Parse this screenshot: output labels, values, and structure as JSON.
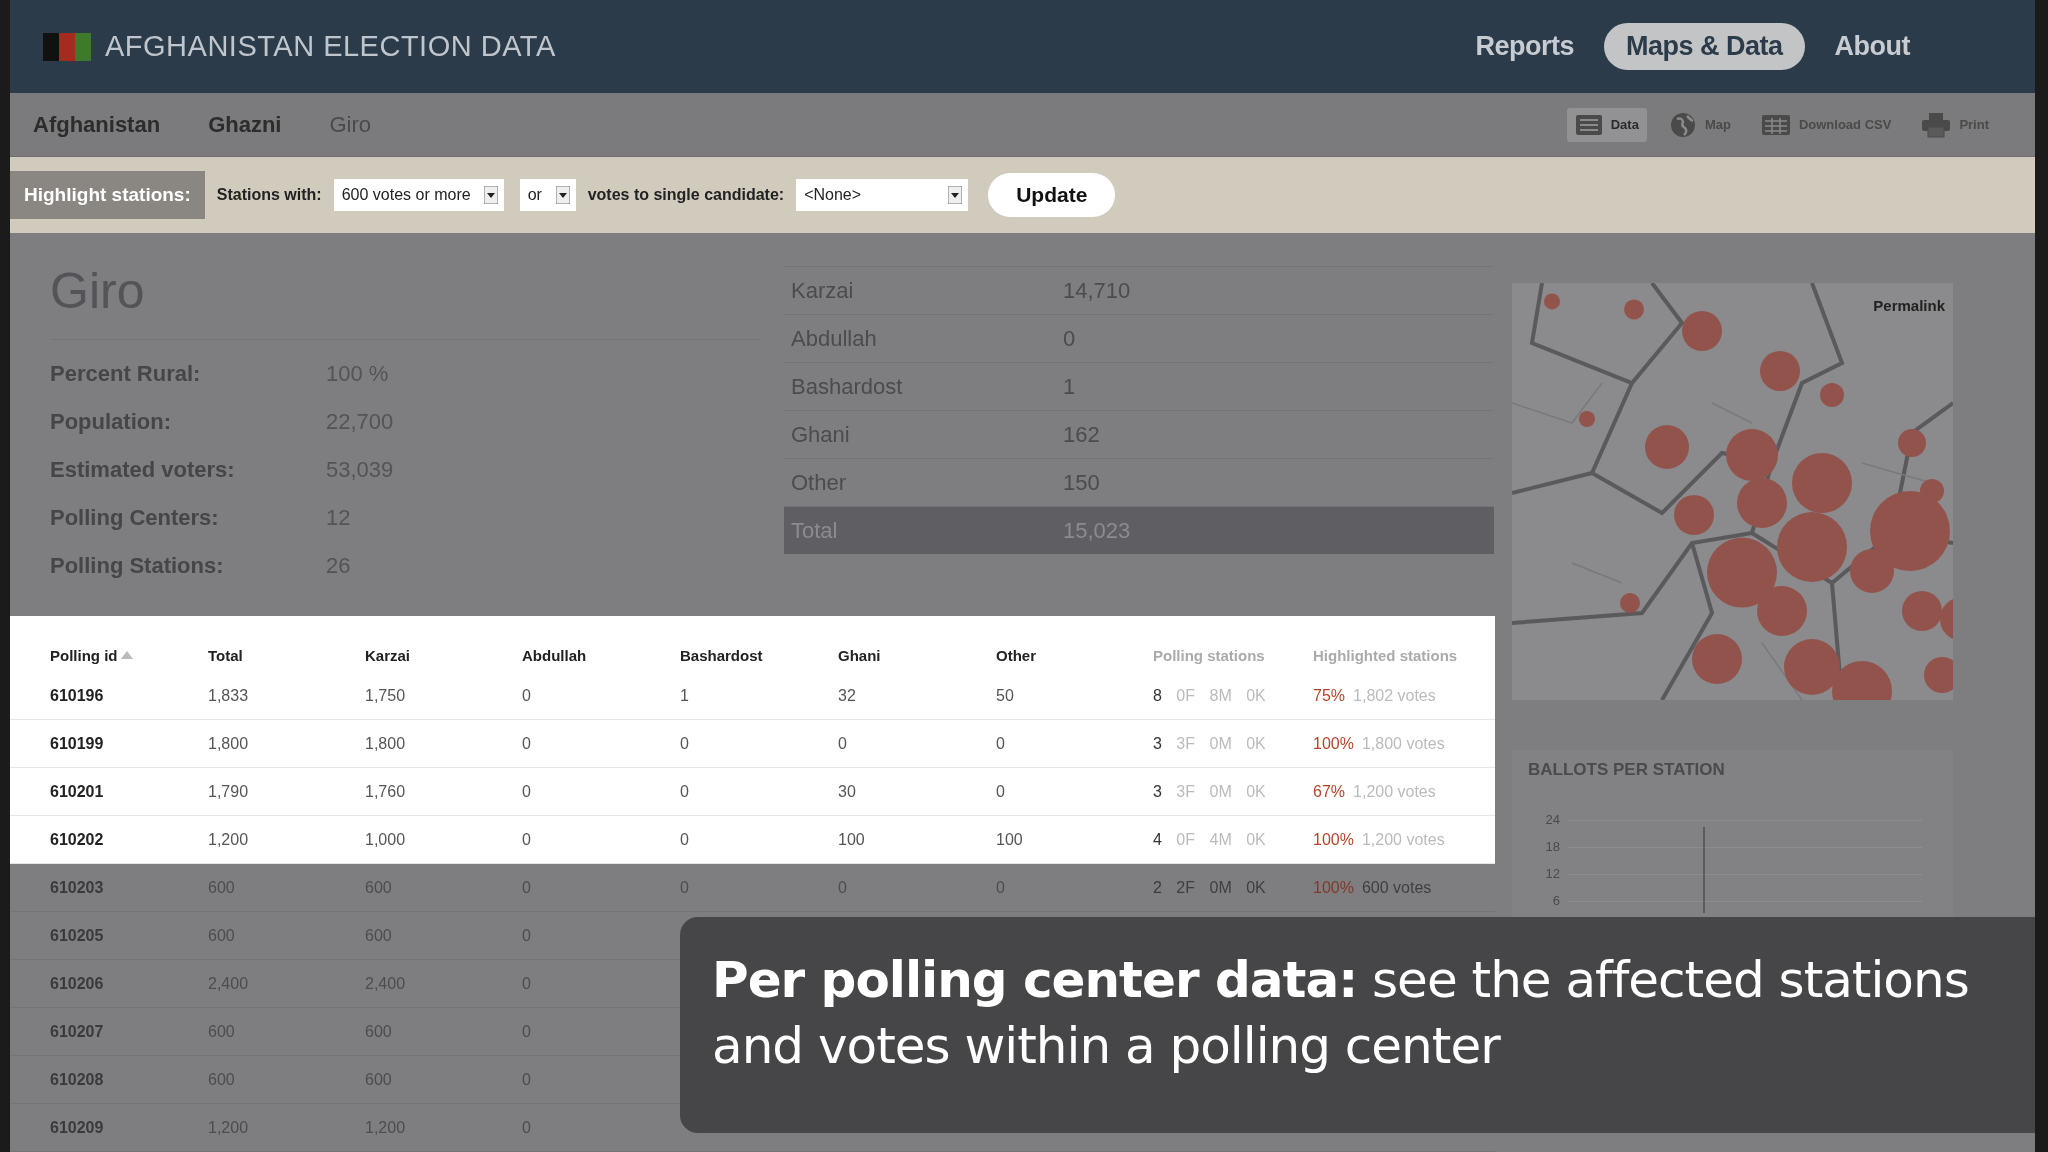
{
  "header": {
    "title": "AFGHANISTAN ELECTION DATA",
    "nav": [
      {
        "label": "Reports",
        "selected": false
      },
      {
        "label": "Maps & Data",
        "selected": true
      },
      {
        "label": "About",
        "selected": false
      }
    ]
  },
  "breadcrumb": [
    {
      "label": "Afghanistan",
      "current": false
    },
    {
      "label": "Ghazni",
      "current": false
    },
    {
      "label": "Giro",
      "current": true
    }
  ],
  "tools": [
    {
      "kind": "data",
      "label": "Data",
      "selected": true
    },
    {
      "kind": "map",
      "label": "Map",
      "selected": false
    },
    {
      "kind": "csv",
      "label": "Download CSV",
      "selected": false
    },
    {
      "kind": "print",
      "label": "Print",
      "selected": false
    }
  ],
  "highlight_bar": {
    "label": "Highlight stations:",
    "stations_label": "Stations with:",
    "threshold": "600 votes or more",
    "operator": "or",
    "candidate_label": "votes to single candidate:",
    "candidate": "<None>",
    "button": "Update"
  },
  "summary": {
    "title": "Giro",
    "stats": [
      {
        "label": "Percent Rural:",
        "value": "100 %"
      },
      {
        "label": "Population:",
        "value": "22,700"
      },
      {
        "label": "Estimated voters:",
        "value": "53,039"
      },
      {
        "label": "Polling Centers:",
        "value": "12"
      },
      {
        "label": "Polling Stations:",
        "value": "26"
      }
    ]
  },
  "candidates": [
    {
      "name": "Karzai",
      "votes": "14,710",
      "total": false
    },
    {
      "name": "Abdullah",
      "votes": "0",
      "total": false
    },
    {
      "name": "Bashardost",
      "votes": "1",
      "total": false
    },
    {
      "name": "Ghani",
      "votes": "162",
      "total": false
    },
    {
      "name": "Other",
      "votes": "150",
      "total": false
    },
    {
      "name": "Total",
      "votes": "15,023",
      "total": true
    }
  ],
  "table": {
    "columns": [
      {
        "label": "Polling id",
        "sorted": true,
        "dimmed": false
      },
      {
        "label": "Total",
        "sorted": false,
        "dimmed": false
      },
      {
        "label": "Karzai",
        "sorted": false,
        "dimmed": false
      },
      {
        "label": "Abdullah",
        "sorted": false,
        "dimmed": false
      },
      {
        "label": "Bashardost",
        "sorted": false,
        "dimmed": false
      },
      {
        "label": "Ghani",
        "sorted": false,
        "dimmed": false
      },
      {
        "label": "Other",
        "sorted": false,
        "dimmed": false
      },
      {
        "label": "Polling stations",
        "sorted": false,
        "dimmed": true
      },
      {
        "label": "Highlighted stations",
        "sorted": false,
        "dimmed": true
      }
    ],
    "rows": [
      {
        "id": "610196",
        "values": [
          "1,833",
          "1,750",
          "0",
          "1",
          "32",
          "50"
        ],
        "stations": {
          "count": "8",
          "f": "0F",
          "m": "8M",
          "k": "0K"
        },
        "highlight": {
          "share": "75%",
          "votes": "1,802 votes"
        },
        "spotlight": true
      },
      {
        "id": "610199",
        "values": [
          "1,800",
          "1,800",
          "0",
          "0",
          "0",
          "0"
        ],
        "stations": {
          "count": "3",
          "f": "3F",
          "m": "0M",
          "k": "0K"
        },
        "highlight": {
          "share": "100%",
          "votes": "1,800 votes"
        },
        "spotlight": true
      },
      {
        "id": "610201",
        "values": [
          "1,790",
          "1,760",
          "0",
          "0",
          "30",
          "0"
        ],
        "stations": {
          "count": "3",
          "f": "3F",
          "m": "0M",
          "k": "0K"
        },
        "highlight": {
          "share": "67%",
          "votes": "1,200 votes"
        },
        "spotlight": true
      },
      {
        "id": "610202",
        "values": [
          "1,200",
          "1,000",
          "0",
          "0",
          "100",
          "100"
        ],
        "stations": {
          "count": "4",
          "f": "0F",
          "m": "4M",
          "k": "0K"
        },
        "highlight": {
          "share": "100%",
          "votes": "1,200 votes"
        },
        "spotlight": true
      },
      {
        "id": "610203",
        "values": [
          "600",
          "600",
          "0",
          "0",
          "0",
          "0"
        ],
        "stations": {
          "count": "2",
          "f": "2F",
          "m": "0M",
          "k": "0K"
        },
        "highlight": {
          "share": "100%",
          "votes": "600 votes"
        },
        "spotlight": false
      },
      {
        "id": "610205",
        "values": [
          "600",
          "600",
          "0"
        ],
        "spotlight": false
      },
      {
        "id": "610206",
        "values": [
          "2,400",
          "2,400",
          "0"
        ],
        "spotlight": false
      },
      {
        "id": "610207",
        "values": [
          "600",
          "600",
          "0"
        ],
        "spotlight": false
      },
      {
        "id": "610208",
        "values": [
          "600",
          "600",
          "0"
        ],
        "spotlight": false
      },
      {
        "id": "610209",
        "values": [
          "1,200",
          "1,200",
          "0"
        ],
        "spotlight": false
      }
    ]
  },
  "sidebar": {
    "map": {
      "kind": "picture",
      "link": "Permalink"
    },
    "ballots": {
      "title": "BALLOTS PER STATION",
      "y_ticks": [
        "24",
        "18",
        "12",
        "6"
      ]
    }
  },
  "caption": "**Per polling center data:** see the affected stations and votes within a polling center"
}
